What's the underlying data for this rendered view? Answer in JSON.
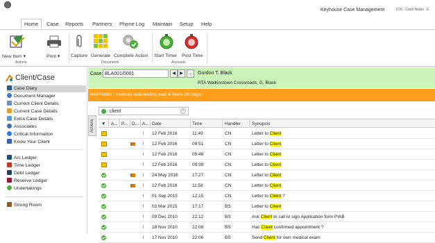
{
  "window": {
    "title": "Keyhouse Case Management",
    "user": "(CN - Carol Nolan - E"
  },
  "menu": {
    "tabs": [
      "Home",
      "Case",
      "Reports",
      "Partners",
      "Phone Log",
      "Maintain",
      "Setup",
      "Help"
    ],
    "active": "Home"
  },
  "ribbon": {
    "new_item": "New Item",
    "print": "Print",
    "actions_group": "Actions",
    "capture": "Capture",
    "generate": "Generate",
    "complete_action": "Complete Action",
    "documents_group": "Documents",
    "start_timer": "Start Timer",
    "post_time": "Post Time",
    "accounts_group": "Accounts"
  },
  "sidebar": {
    "heading": "Client/Case",
    "items": [
      {
        "label": "Case Diary",
        "color": "#2e5c8a"
      },
      {
        "label": "Document Manager",
        "color": "#3b7dc4"
      },
      {
        "label": "Current Client Details",
        "color": "#6a8fc2"
      },
      {
        "label": "Current Case Details",
        "color": "#e0a030"
      },
      {
        "label": "Extra Case Details",
        "color": "#5b9bd5"
      },
      {
        "label": "Associates",
        "color": "#3a6fb0"
      },
      {
        "label": "Critical Information",
        "color": "#2a7fd4"
      },
      {
        "label": "Know Your Client",
        "color": "#3b5ea8"
      }
    ],
    "ledgers": [
      {
        "label": "A/c Ledger",
        "color": "#1f4e79"
      },
      {
        "label": "Time Ledger",
        "color": "#c0392b"
      },
      {
        "label": "Debt Ledger",
        "color": "#2c3e50"
      },
      {
        "label": "Reserve Ledger",
        "color": "#8e1c2c"
      },
      {
        "label": "Undertakings",
        "color": "#4caf3a"
      }
    ],
    "strong_room": "Strong Room"
  },
  "case": {
    "label": "Case:",
    "code": "BLA001/0001",
    "client": "Gordon T. Black",
    "matter": "RTA Walkinstown Crossroads, G. Black",
    "warning": "WARNING : Invoices outstanding over 4 Years 28 Days ."
  },
  "diary": {
    "actions_tab": "Actions",
    "search": "client",
    "columns": [
      "A...",
      "P...",
      "D...",
      "A...",
      "Date",
      "Time",
      "Handler",
      "Synopsis"
    ],
    "rows": [
      {
        "icon": "doc",
        "flag": false,
        "date": "12 Feb 2016",
        "time": "11:49",
        "handler": "CN",
        "pre": "Letter to ",
        "hl": "Client",
        "post": ""
      },
      {
        "icon": "doc",
        "flag": true,
        "date": "12 Feb 2016",
        "time": "09:51",
        "handler": "CN",
        "pre": "Letter to ",
        "hl": "Client",
        "post": ""
      },
      {
        "icon": "doc",
        "flag": false,
        "date": "12 Feb 2016",
        "time": "09:46",
        "handler": "CN",
        "pre": "Letter to ",
        "hl": "Client",
        "post": ""
      },
      {
        "icon": "doc",
        "flag": false,
        "date": "12 Feb 2016",
        "time": "09:39",
        "handler": "CN",
        "pre": "Letter to ",
        "hl": "Client",
        "post": ""
      },
      {
        "icon": "tick",
        "flag": true,
        "date": "24 May 2016",
        "time": "17:27",
        "handler": "CN",
        "pre": "Letter to ",
        "hl": "Client",
        "post": ""
      },
      {
        "icon": "tick",
        "flag": true,
        "date": "12 Feb 2016",
        "time": "11:58",
        "handler": "CN",
        "pre": "Letter to ",
        "hl": "Client",
        "post": ""
      },
      {
        "icon": "tick",
        "flag": false,
        "date": "01 Sep 2015",
        "time": "12:15",
        "handler": "CN",
        "pre": "Letter to ",
        "hl": "Client",
        "post": " ?"
      },
      {
        "icon": "tick",
        "flag": false,
        "date": "03 Mar 2015",
        "time": "17:17",
        "handler": "BS",
        "pre": "Letter to ",
        "hl": "Client",
        "post": ""
      },
      {
        "icon": "tick",
        "flag": false,
        "date": "09 Dec 2010",
        "time": "22:12",
        "handler": "BS",
        "pre": "Ask ",
        "hl": "Client",
        "post": " to call to sign Application form PIAB"
      },
      {
        "icon": "tick",
        "flag": false,
        "date": "18 Nov 2010",
        "time": "22:08",
        "handler": "BS",
        "pre": "Has ",
        "hl": "Client",
        "post": " confirmed appointment ?"
      },
      {
        "icon": "tick",
        "flag": false,
        "date": "17 Nov 2010",
        "time": "22:06",
        "handler": "BS",
        "pre": "Send ",
        "hl": "Client",
        "post": " for own medical exam"
      }
    ]
  }
}
